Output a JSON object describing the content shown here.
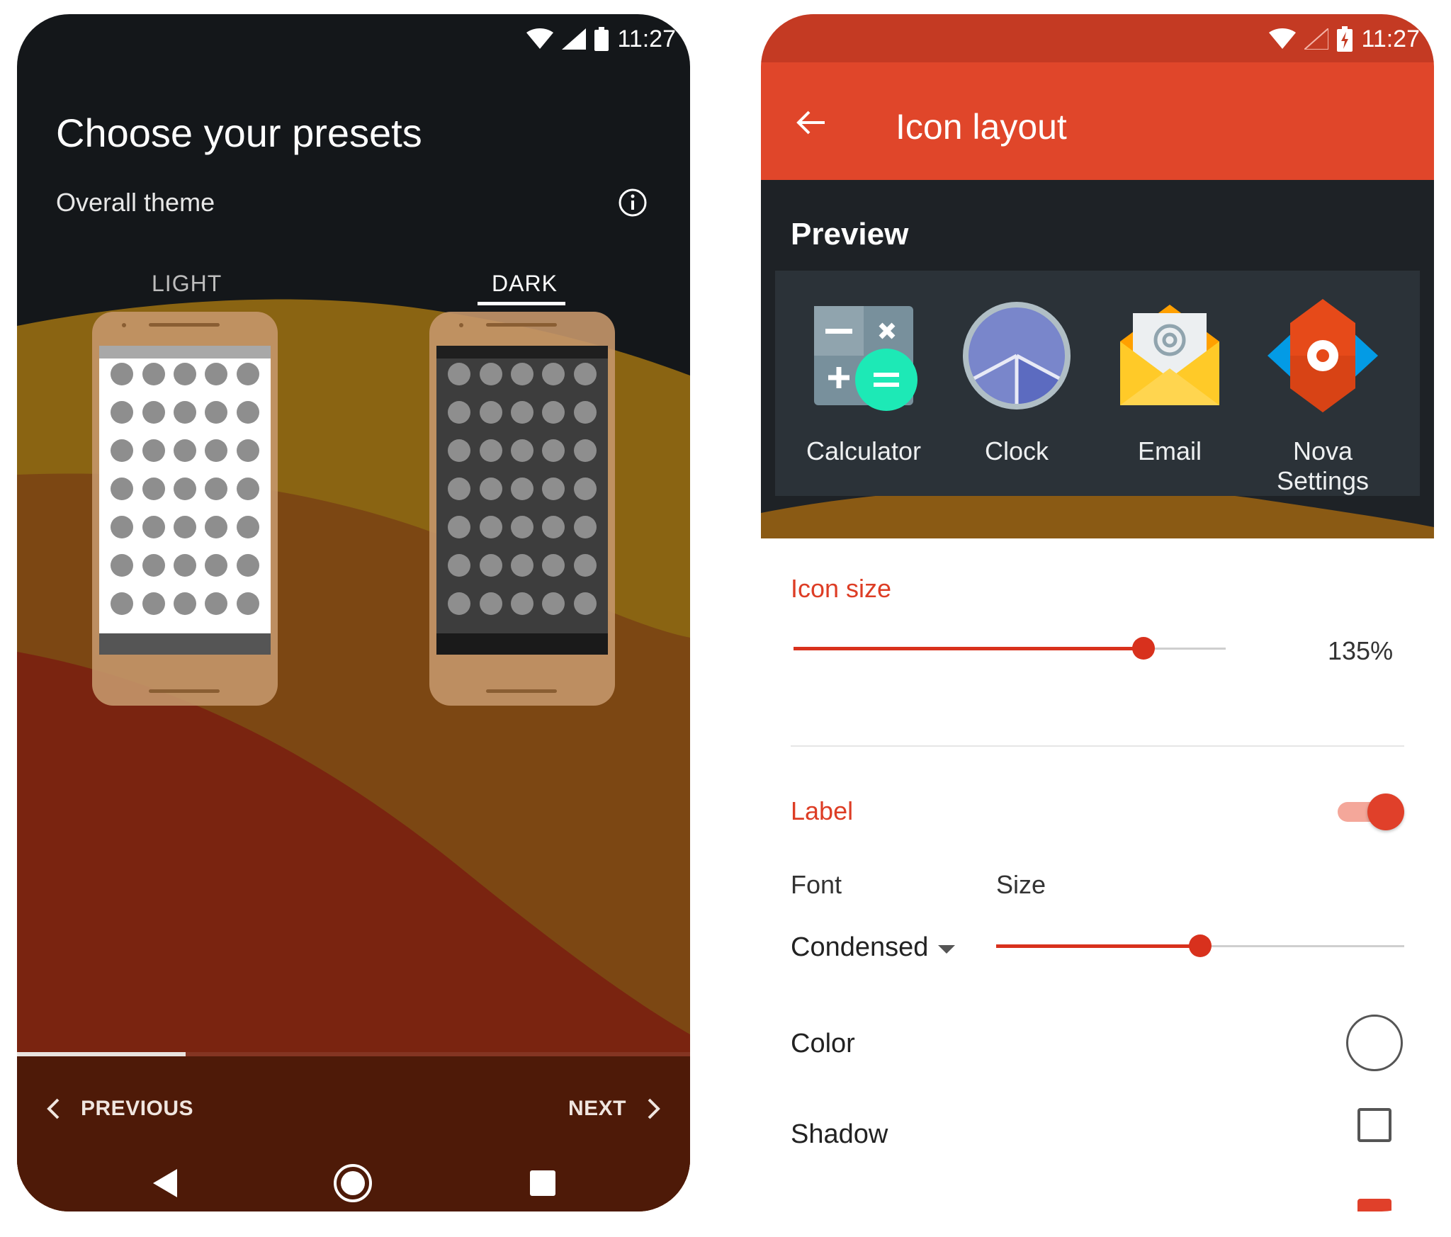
{
  "left_phone": {
    "status": {
      "time": "11:27"
    },
    "title": "Choose your presets",
    "subtitle": "Overall theme",
    "tabs": [
      {
        "label": "LIGHT"
      },
      {
        "label": "DARK",
        "selected": true
      }
    ],
    "onboarding_progress": 0.25,
    "nav": {
      "previous_label": "PREVIOUS",
      "next_label": "NEXT"
    },
    "colors": {
      "background": "#14171a",
      "wave_gold": "#8a6412",
      "wave_brown": "#7b3d12",
      "wave_red": "#7a2410",
      "bottom_bar": "#4e1a08"
    }
  },
  "right_phone": {
    "status": {
      "time": "11:27"
    },
    "toolbar": {
      "title": "Icon layout"
    },
    "preview": {
      "label": "Preview",
      "apps": [
        {
          "label": "Calculator",
          "icon": "calculator-icon"
        },
        {
          "label": "Clock",
          "icon": "clock-icon"
        },
        {
          "label": "Email",
          "icon": "email-icon"
        },
        {
          "label": "Nova Settings",
          "icon": "nova-settings-icon"
        }
      ]
    },
    "icon_size": {
      "title": "Icon size",
      "value_text": "135%",
      "slider_fraction": 0.81
    },
    "label_section": {
      "title": "Label",
      "toggle_on": true,
      "font_label": "Font",
      "font_value": "Condensed",
      "size_label": "Size",
      "size_slider_fraction": 0.5
    },
    "color_label": "Color",
    "shadow_label": "Shadow",
    "colors": {
      "accent": "#e0462a",
      "status": "#c43a23",
      "preview_bg": "#1e2226",
      "preview_card": "#2b3238"
    }
  }
}
